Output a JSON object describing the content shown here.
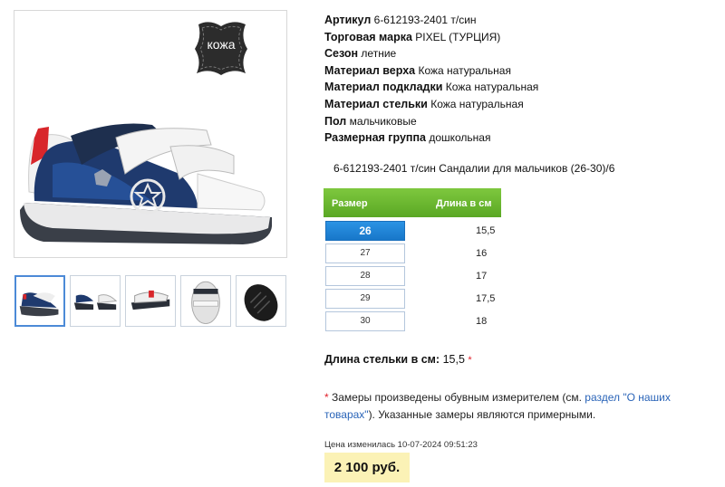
{
  "gallery": {
    "badge_text": "кожа",
    "main_image": "sandal-side-view-image",
    "thumbnails": [
      {
        "name": "sandal-side-thumb",
        "active": true
      },
      {
        "name": "sandal-pair-thumb",
        "active": false
      },
      {
        "name": "sandal-back-thumb",
        "active": false
      },
      {
        "name": "sandal-top-thumb",
        "active": false
      },
      {
        "name": "sole-thumb",
        "active": false
      }
    ]
  },
  "specs": [
    {
      "label": "Артикул",
      "value": "6-612193-2401 т/син"
    },
    {
      "label": "Торговая марка",
      "value": "PIXEL (ТУРЦИЯ)"
    },
    {
      "label": "Сезон",
      "value": "летние"
    },
    {
      "label": "Материал верха",
      "value": "Кожа натуральная"
    },
    {
      "label": "Материал подкладки",
      "value": "Кожа натуральная"
    },
    {
      "label": "Материал стельки",
      "value": "Кожа натуральная"
    },
    {
      "label": "Пол",
      "value": "мальчиковые"
    },
    {
      "label": "Размерная группа",
      "value": "дошкольная"
    }
  ],
  "description": "6-612193-2401 т/син Сандалии для мальчиков (26-30)/6",
  "size_table": {
    "header_size": "Размер",
    "header_length": "Длина в см",
    "rows": [
      {
        "size": "26",
        "length": "15,5",
        "selected": true
      },
      {
        "size": "27",
        "length": "16",
        "selected": false
      },
      {
        "size": "28",
        "length": "17",
        "selected": false
      },
      {
        "size": "29",
        "length": "17,5",
        "selected": false
      },
      {
        "size": "30",
        "length": "18",
        "selected": false
      }
    ]
  },
  "insole": {
    "label": "Длина стельки в см:",
    "value": "15,5",
    "star": "*"
  },
  "note": {
    "star": "*",
    "text_before": " Замеры произведены обувным измерителем (см. ",
    "link_text": "раздел \"О наших товарах\"",
    "text_after": "). Указанные замеры являются примерными."
  },
  "price": {
    "changed_text": "Цена изменилась 10-07-2024 09:51:23",
    "value": "2 100 руб."
  },
  "colors": {
    "accent_green": "#6cba30",
    "accent_blue": "#1f82d6",
    "price_bg": "#fbf2b6",
    "link": "#2a64b8",
    "star": "#e0202a"
  }
}
